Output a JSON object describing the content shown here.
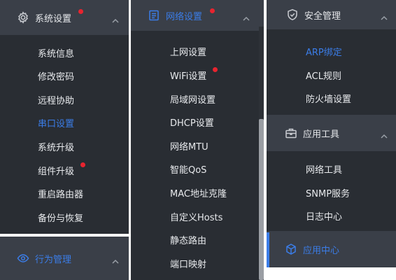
{
  "colors": {
    "accent": "#3b7de8",
    "badge": "#e8242f",
    "header_bg": "#3a3f48",
    "submenu_bg": "#292d33"
  },
  "panel1": {
    "system_settings": {
      "label": "系统设置",
      "icon": "gear-icon",
      "items": [
        {
          "label": "系统信息"
        },
        {
          "label": "修改密码"
        },
        {
          "label": "远程协助"
        },
        {
          "label": "串口设置"
        },
        {
          "label": "系统升级"
        },
        {
          "label": "组件升级"
        },
        {
          "label": "重启路由器"
        },
        {
          "label": "备份与恢复"
        }
      ]
    },
    "behavior_mgmt": {
      "label": "行为管理",
      "icon": "eye-icon"
    }
  },
  "panel2": {
    "network_settings": {
      "label": "网络设置",
      "icon": "document-icon",
      "items": [
        {
          "label": "上网设置"
        },
        {
          "label": "WiFi设置"
        },
        {
          "label": "局域网设置"
        },
        {
          "label": "DHCP设置"
        },
        {
          "label": "网络MTU"
        },
        {
          "label": "智能QoS"
        },
        {
          "label": "MAC地址克隆"
        },
        {
          "label": "自定义Hosts"
        },
        {
          "label": "静态路由"
        },
        {
          "label": "端口映射"
        }
      ]
    }
  },
  "panel3": {
    "security_mgmt": {
      "label": "安全管理",
      "icon": "shield-icon",
      "items": [
        {
          "label": "ARP绑定"
        },
        {
          "label": "ACL规则"
        },
        {
          "label": "防火墙设置"
        }
      ]
    },
    "app_tools": {
      "label": "应用工具",
      "icon": "briefcase-icon",
      "items": [
        {
          "label": "网络工具"
        },
        {
          "label": "SNMP服务"
        },
        {
          "label": "日志中心"
        }
      ]
    },
    "app_center": {
      "label": "应用中心",
      "icon": "cube-icon"
    }
  }
}
